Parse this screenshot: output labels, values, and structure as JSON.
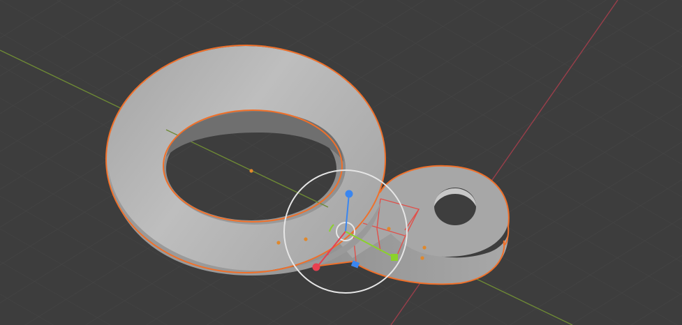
{
  "viewport": {
    "background": "#3d3d3d",
    "grid_color": "#474747",
    "x_axis_color": "#9a3e4a",
    "y_axis_color": "#6e8a35"
  },
  "selection": {
    "outline_color": "#f0702a",
    "origin_color": "#e0882c"
  },
  "gizmo": {
    "circle_color": "#e6e6e6",
    "x_color": "#e84050",
    "y_color": "#8bd22a",
    "z_color": "#3a86f0",
    "plane_color": "#3a86f0"
  },
  "objects": [
    {
      "name": "torus",
      "icon": "torus-mesh",
      "selected": true
    },
    {
      "name": "tab-with-hole",
      "icon": "cylinder-mesh",
      "selected": true
    }
  ]
}
